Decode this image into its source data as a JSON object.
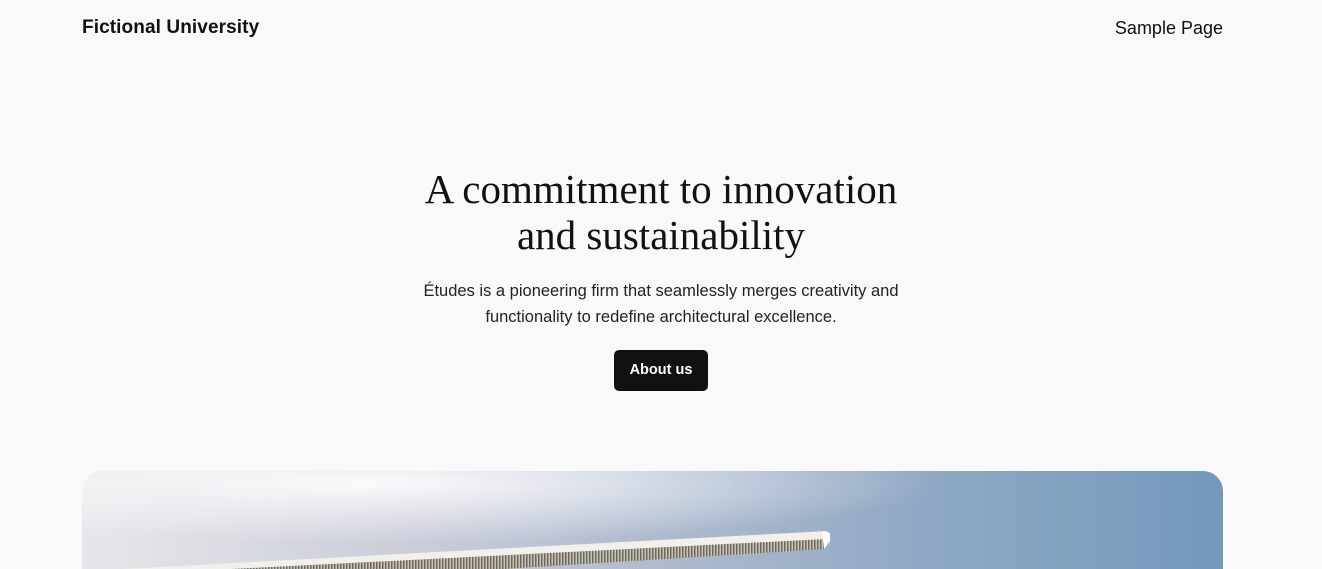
{
  "header": {
    "site_title": "Fictional University",
    "nav": [
      {
        "label": "Sample Page"
      }
    ]
  },
  "hero": {
    "title_line1": "A commitment to innovation",
    "title_line2": "and sustainability",
    "subtitle_line1": "Études is a pioneering firm that seamlessly merges creativity and",
    "subtitle_line2": "functionality to redefine architectural excellence.",
    "button_label": "About us"
  },
  "colors": {
    "background": "#f9f9f9",
    "text": "#111111",
    "button_bg": "#111111",
    "button_text": "#ffffff"
  }
}
